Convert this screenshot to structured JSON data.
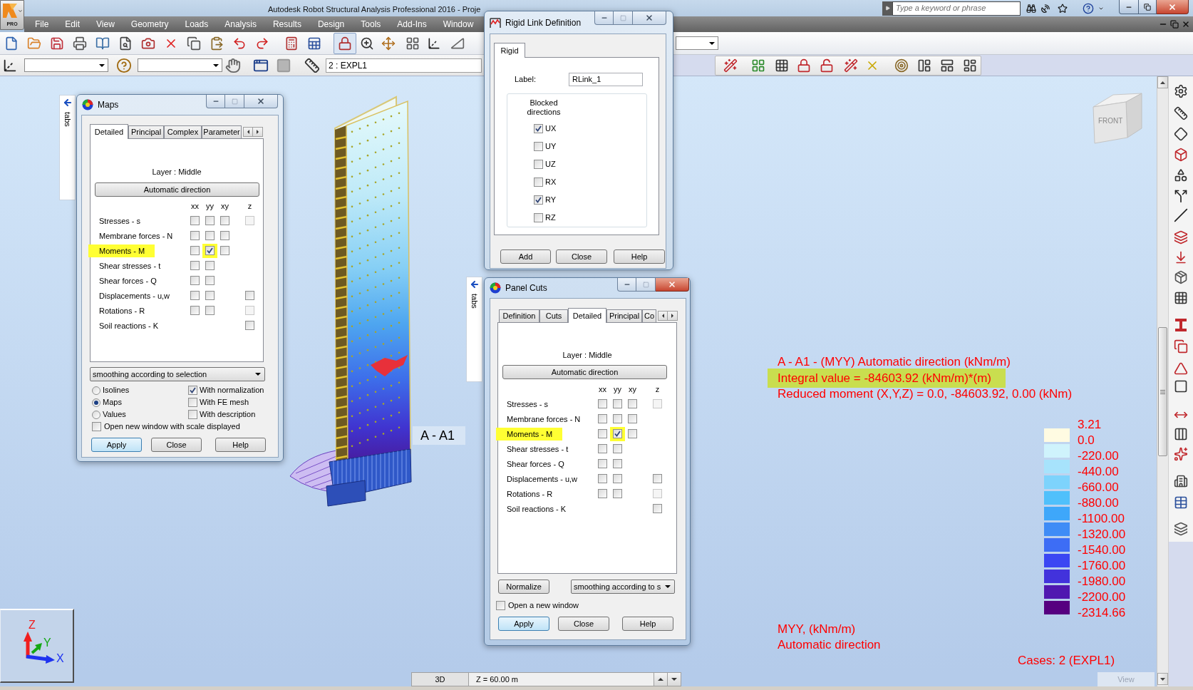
{
  "window": {
    "app_button": "PRO",
    "title": "Autodesk Robot Structural Analysis Professional 2016 - Proje",
    "search": {
      "placeholder": "Type a keyword or phrase"
    }
  },
  "menu": [
    "File",
    "Edit",
    "View",
    "Geometry",
    "Loads",
    "Analysis",
    "Results",
    "Design",
    "Tools",
    "Add-Ins",
    "Window"
  ],
  "toolbar": {
    "lock_button": {
      "pressed": true
    },
    "case_field": {
      "value": "2 : EXPL1"
    }
  },
  "maps_dialog": {
    "title": "Maps",
    "active": false,
    "side_tab": "tabs",
    "tabs": [
      {
        "label": "Detailed",
        "selected": true
      },
      {
        "label": "Principal",
        "selected": false
      },
      {
        "label": "Complex",
        "selected": false
      },
      {
        "label": "Parameter",
        "selected": false
      }
    ],
    "layer": "Layer : Middle",
    "direction_button": "Automatic direction",
    "columns": [
      "xx",
      "yy",
      "xy",
      "z"
    ],
    "rows": [
      {
        "label": "Stresses - s",
        "highlighted": false,
        "xx": {
          "checked": false,
          "disabled": false,
          "highlighted": false
        },
        "yy": {
          "checked": false,
          "disabled": false,
          "highlighted": false
        },
        "xy": {
          "checked": false,
          "disabled": false,
          "highlighted": false
        },
        "z": {
          "checked": false,
          "disabled": true,
          "highlighted": false
        }
      },
      {
        "label": "Membrane forces - N",
        "highlighted": false,
        "xx": {
          "checked": false,
          "disabled": false,
          "highlighted": false
        },
        "yy": {
          "checked": false,
          "disabled": false,
          "highlighted": false
        },
        "xy": {
          "checked": false,
          "disabled": false,
          "highlighted": false
        }
      },
      {
        "label": "Moments - M",
        "highlighted": true,
        "xx": {
          "checked": false,
          "disabled": false,
          "highlighted": false
        },
        "yy": {
          "checked": true,
          "disabled": false,
          "highlighted": true
        },
        "xy": {
          "checked": false,
          "disabled": false,
          "highlighted": false
        }
      },
      {
        "label": "Shear stresses - t",
        "highlighted": false,
        "xx": {
          "checked": false,
          "disabled": false,
          "highlighted": false
        },
        "yy": {
          "checked": false,
          "disabled": false,
          "highlighted": false
        }
      },
      {
        "label": "Shear forces - Q",
        "highlighted": false,
        "xx": {
          "checked": false,
          "disabled": false,
          "highlighted": false
        },
        "yy": {
          "checked": false,
          "disabled": false,
          "highlighted": false
        }
      },
      {
        "label": "Displacements - u,w",
        "highlighted": false,
        "xx": {
          "checked": false,
          "disabled": false,
          "highlighted": false
        },
        "yy": {
          "checked": false,
          "disabled": false,
          "highlighted": false
        },
        "z": {
          "checked": false,
          "disabled": false,
          "highlighted": false
        }
      },
      {
        "label": "Rotations - R",
        "highlighted": false,
        "xx": {
          "checked": false,
          "disabled": false,
          "highlighted": false
        },
        "yy": {
          "checked": false,
          "disabled": false,
          "highlighted": false
        },
        "z": {
          "checked": false,
          "disabled": true,
          "highlighted": false
        }
      },
      {
        "label": "Soil reactions - K",
        "highlighted": false,
        "z": {
          "checked": false,
          "disabled": false,
          "highlighted": false
        }
      }
    ],
    "smoothing": "smoothing according to selection",
    "display": [
      {
        "label": "Isolines",
        "selected": false
      },
      {
        "label": "Maps",
        "selected": true
      },
      {
        "label": "Values",
        "selected": false
      }
    ],
    "options": [
      {
        "label": "With normalization",
        "checked": true
      },
      {
        "label": "With FE mesh",
        "checked": false
      },
      {
        "label": "With description",
        "checked": false
      }
    ],
    "scale_window": {
      "label": "Open new window with scale displayed",
      "checked": false
    },
    "buttons": [
      {
        "label": "Apply",
        "focused": true
      },
      {
        "label": "Close",
        "focused": false
      },
      {
        "label": "Help",
        "focused": false
      }
    ]
  },
  "rigid_link_dialog": {
    "title": "Rigid Link Definition",
    "active": false,
    "tabs": [
      {
        "label": "Rigid",
        "selected": true
      }
    ],
    "label_field": {
      "label": "Label:",
      "value": "RLink_1"
    },
    "group_title": "Blocked directions",
    "directions": [
      {
        "label": "UX",
        "checked": true
      },
      {
        "label": "UY",
        "checked": false
      },
      {
        "label": "UZ",
        "checked": false
      },
      {
        "label": "RX",
        "checked": false
      },
      {
        "label": "RY",
        "checked": true
      },
      {
        "label": "RZ",
        "checked": false
      }
    ],
    "buttons": [
      {
        "label": "Add",
        "focused": false
      },
      {
        "label": "Close",
        "focused": false
      },
      {
        "label": "Help",
        "focused": false
      }
    ]
  },
  "panel_cuts_dialog": {
    "title": "Panel Cuts",
    "active": true,
    "side_tab": "tabs",
    "tabs": [
      {
        "label": "Definition",
        "selected": false
      },
      {
        "label": "Cuts",
        "selected": false
      },
      {
        "label": "Detailed",
        "selected": true
      },
      {
        "label": "Principal",
        "selected": false
      },
      {
        "label": "Co",
        "selected": false
      }
    ],
    "layer": "Layer : Middle",
    "direction_button": "Automatic direction",
    "columns": [
      "xx",
      "yy",
      "xy",
      "z"
    ],
    "rows": [
      {
        "label": "Stresses - s",
        "highlighted": false,
        "xx": {
          "checked": false,
          "disabled": false,
          "highlighted": false
        },
        "yy": {
          "checked": false,
          "disabled": false,
          "highlighted": false
        },
        "xy": {
          "checked": false,
          "disabled": false,
          "highlighted": false
        },
        "z": {
          "checked": false,
          "disabled": true,
          "highlighted": false
        }
      },
      {
        "label": "Membrane forces - N",
        "highlighted": false,
        "xx": {
          "checked": false,
          "disabled": false,
          "highlighted": false
        },
        "yy": {
          "checked": false,
          "disabled": false,
          "highlighted": false
        },
        "xy": {
          "checked": false,
          "disabled": false,
          "highlighted": false
        }
      },
      {
        "label": "Moments - M",
        "highlighted": true,
        "xx": {
          "checked": false,
          "disabled": false,
          "highlighted": false
        },
        "yy": {
          "checked": true,
          "disabled": false,
          "highlighted": true
        },
        "xy": {
          "checked": false,
          "disabled": false,
          "highlighted": false
        }
      },
      {
        "label": "Shear stresses - t",
        "highlighted": false,
        "xx": {
          "checked": false,
          "disabled": false,
          "highlighted": false
        },
        "yy": {
          "checked": false,
          "disabled": false,
          "highlighted": false
        }
      },
      {
        "label": "Shear forces - Q",
        "highlighted": false,
        "xx": {
          "checked": false,
          "disabled": false,
          "highlighted": false
        },
        "yy": {
          "checked": false,
          "disabled": false,
          "highlighted": false
        }
      },
      {
        "label": "Displacements - u,w",
        "highlighted": false,
        "xx": {
          "checked": false,
          "disabled": false,
          "highlighted": false
        },
        "yy": {
          "checked": false,
          "disabled": false,
          "highlighted": false
        },
        "z": {
          "checked": false,
          "disabled": false,
          "highlighted": false
        }
      },
      {
        "label": "Rotations - R",
        "highlighted": false,
        "xx": {
          "checked": false,
          "disabled": false,
          "highlighted": false
        },
        "yy": {
          "checked": false,
          "disabled": false,
          "highlighted": false
        },
        "z": {
          "checked": false,
          "disabled": true,
          "highlighted": false
        }
      },
      {
        "label": "Soil reactions - K",
        "highlighted": false,
        "z": {
          "checked": false,
          "disabled": false,
          "highlighted": false
        }
      }
    ],
    "normalize_button": "Normalize",
    "smoothing": "smoothing according to s",
    "new_window": {
      "label": "Open a new window",
      "checked": false
    },
    "buttons": [
      {
        "label": "Apply",
        "focused": true
      },
      {
        "label": "Close",
        "focused": false
      },
      {
        "label": "Help",
        "focused": false
      }
    ]
  },
  "viewport": {
    "section_label": "A - A1",
    "cube_label": "FRONT",
    "axes": [
      {
        "label": "Z",
        "color": "#f01e1e"
      },
      {
        "label": "Y",
        "color": "#14a814"
      },
      {
        "label": "X",
        "color": "#1e32f0"
      }
    ],
    "result_lines": [
      {
        "text": "A - A1 - (MYY) Automatic direction (kNm/m)",
        "highlighted": false
      },
      {
        "text": "Integral value = -84603.92 (kNm/m)*(m)",
        "highlighted": true
      },
      {
        "text": "Reduced moment (X,Y,Z) = 0.0, -84603.92, 0.00 (kNm)",
        "highlighted": false
      }
    ],
    "legend": {
      "labels": [
        "3.21",
        "0.0",
        "-220.00",
        "-440.00",
        "-660.00",
        "-880.00",
        "-1100.00",
        "-1320.00",
        "-1540.00",
        "-1760.00",
        "-1980.00",
        "-2200.00",
        "-2314.66"
      ],
      "swatches": [
        {
          "color": "#fffbe2"
        },
        {
          "color": "#cff3fc"
        },
        {
          "color": "#a7e3fc"
        },
        {
          "color": "#7dd3fc"
        },
        {
          "color": "#50c0fb"
        },
        {
          "color": "#3ea7fa"
        },
        {
          "color": "#3f8cf6"
        },
        {
          "color": "#3d6df5"
        },
        {
          "color": "#3b47f3"
        },
        {
          "color": "#4232dc"
        },
        {
          "color": "#5018b0"
        },
        {
          "color": "#560080"
        }
      ]
    },
    "map_caption": [
      "MYY, (kNm/m)",
      "Automatic direction"
    ],
    "cases": "Cases: 2 (EXPL1)"
  },
  "status_bar": {
    "view_mode": "3D",
    "z_field": "Z = 60.00 m",
    "view_tab": "View"
  }
}
